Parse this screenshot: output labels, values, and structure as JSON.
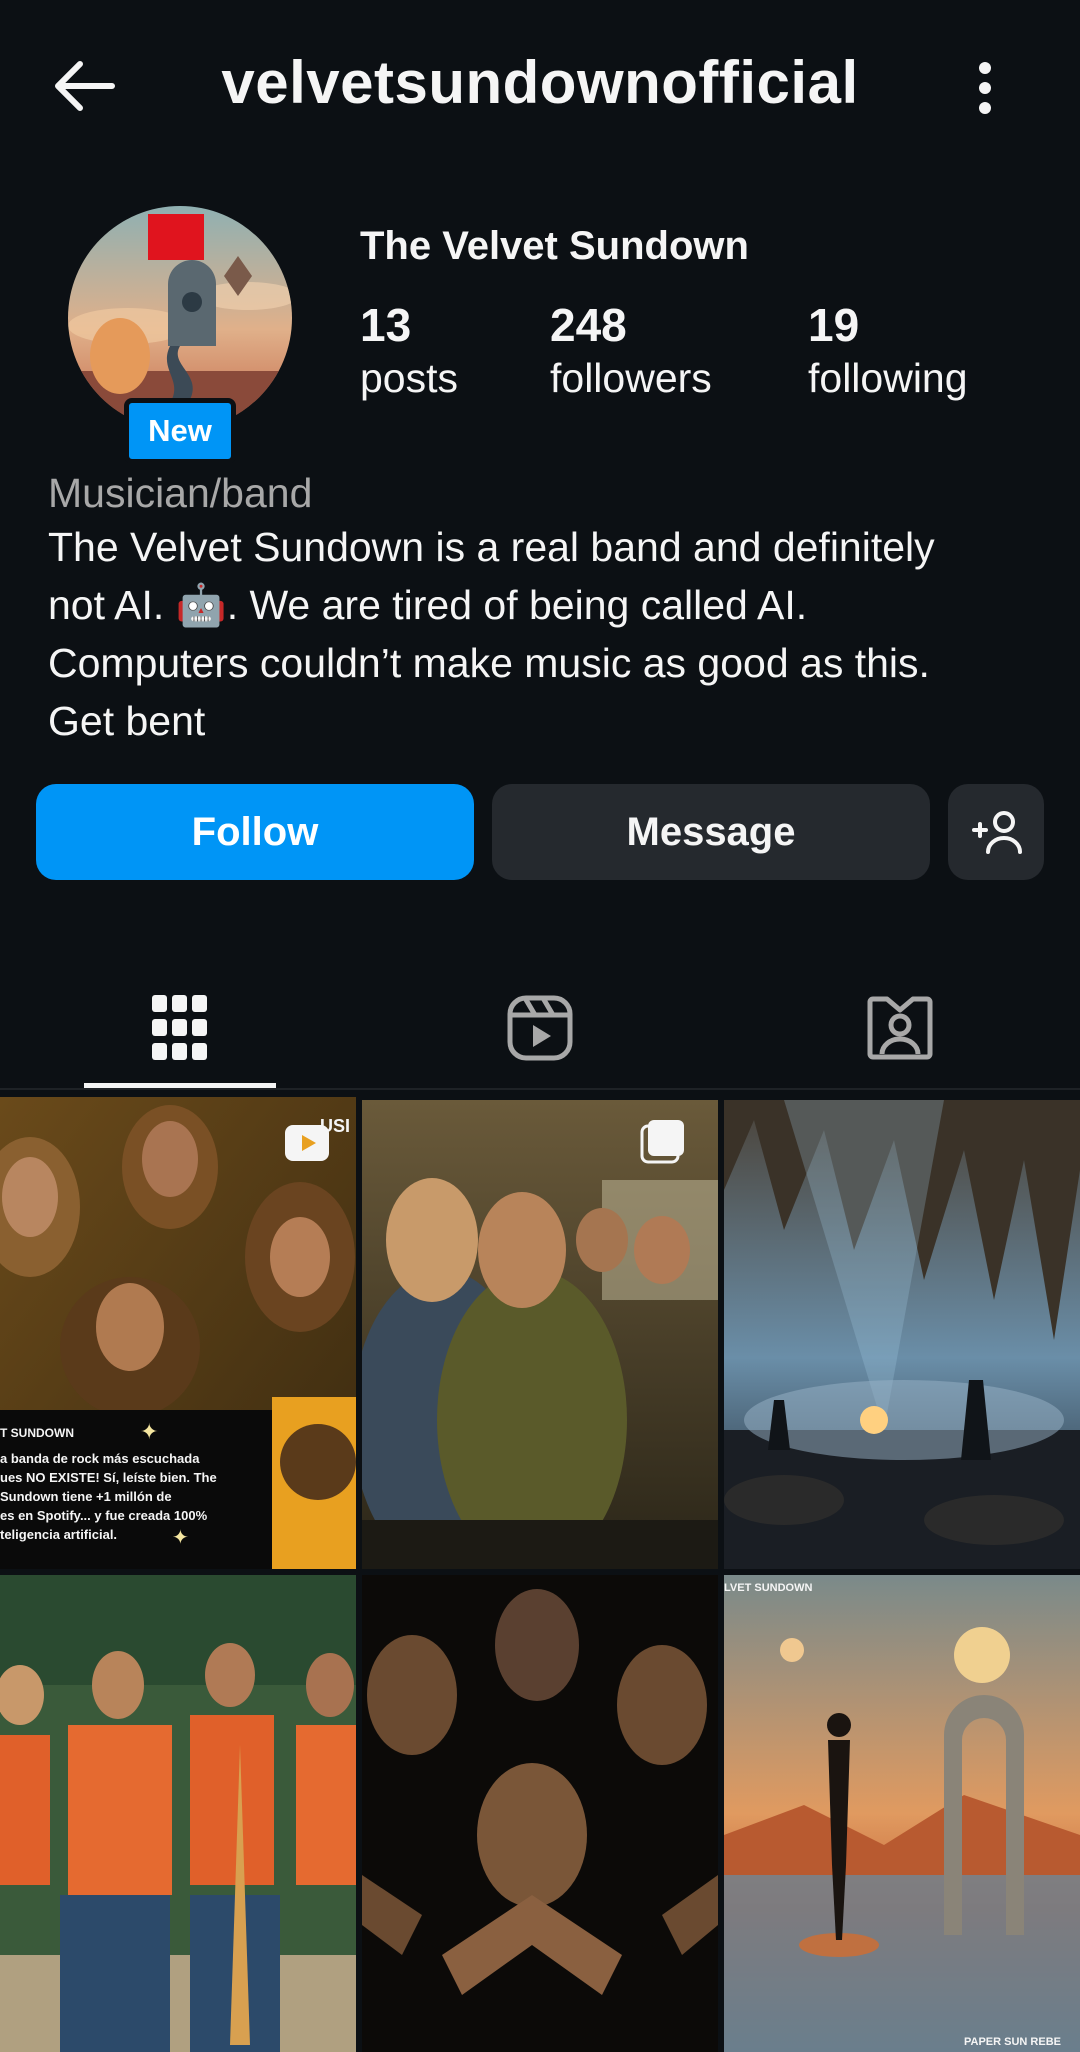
{
  "header": {
    "username": "velvetsundownofficial",
    "back_icon": "arrow-left-icon",
    "menu_icon": "more-vertical-icon"
  },
  "profile": {
    "display_name": "The Velvet Sundown",
    "new_badge": "New",
    "stats": [
      {
        "value": "13",
        "label": "posts"
      },
      {
        "value": "248",
        "label": "followers"
      },
      {
        "value": "19",
        "label": "following"
      }
    ],
    "category": "Musician/band",
    "bio": "The Velvet Sundown is a real band and definitely\nnot AI. 🤖. We are tired of being called AI.\nComputers couldn’t make music as good as this.\nGet bent"
  },
  "actions": {
    "follow_label": "Follow",
    "message_label": "Message",
    "add_person_icon": "add-person-icon"
  },
  "tabs": [
    {
      "name": "posts",
      "icon": "grid-icon",
      "active": true
    },
    {
      "name": "reels",
      "icon": "reels-icon",
      "active": false
    },
    {
      "name": "tagged",
      "icon": "tagged-person-icon",
      "active": false
    }
  ],
  "grid": {
    "post1": {
      "type": "reel",
      "overlay_title": "T SUNDOWN",
      "overlay_lines": [
        "a banda de rock más escuchada",
        "ues NO EXISTE! Sí, leíste bien. The",
        "Sundown tiene +1 millón de",
        "es en Spotify... y fue creada 100%",
        "teligencia artificial."
      ],
      "corner_text": "USI IA"
    },
    "post2": {
      "type": "carousel"
    },
    "post3": {
      "type": "image"
    },
    "post4": {
      "type": "image"
    },
    "post5": {
      "type": "image"
    },
    "post6": {
      "type": "image",
      "top_text": "LVET SUNDOWN",
      "bottom_text": "PAPER SUN REBE"
    }
  },
  "colors": {
    "background": "#0c1014",
    "accent": "#0095f6",
    "secondary_button": "#25292e",
    "muted_text": "#a8a8a8"
  }
}
